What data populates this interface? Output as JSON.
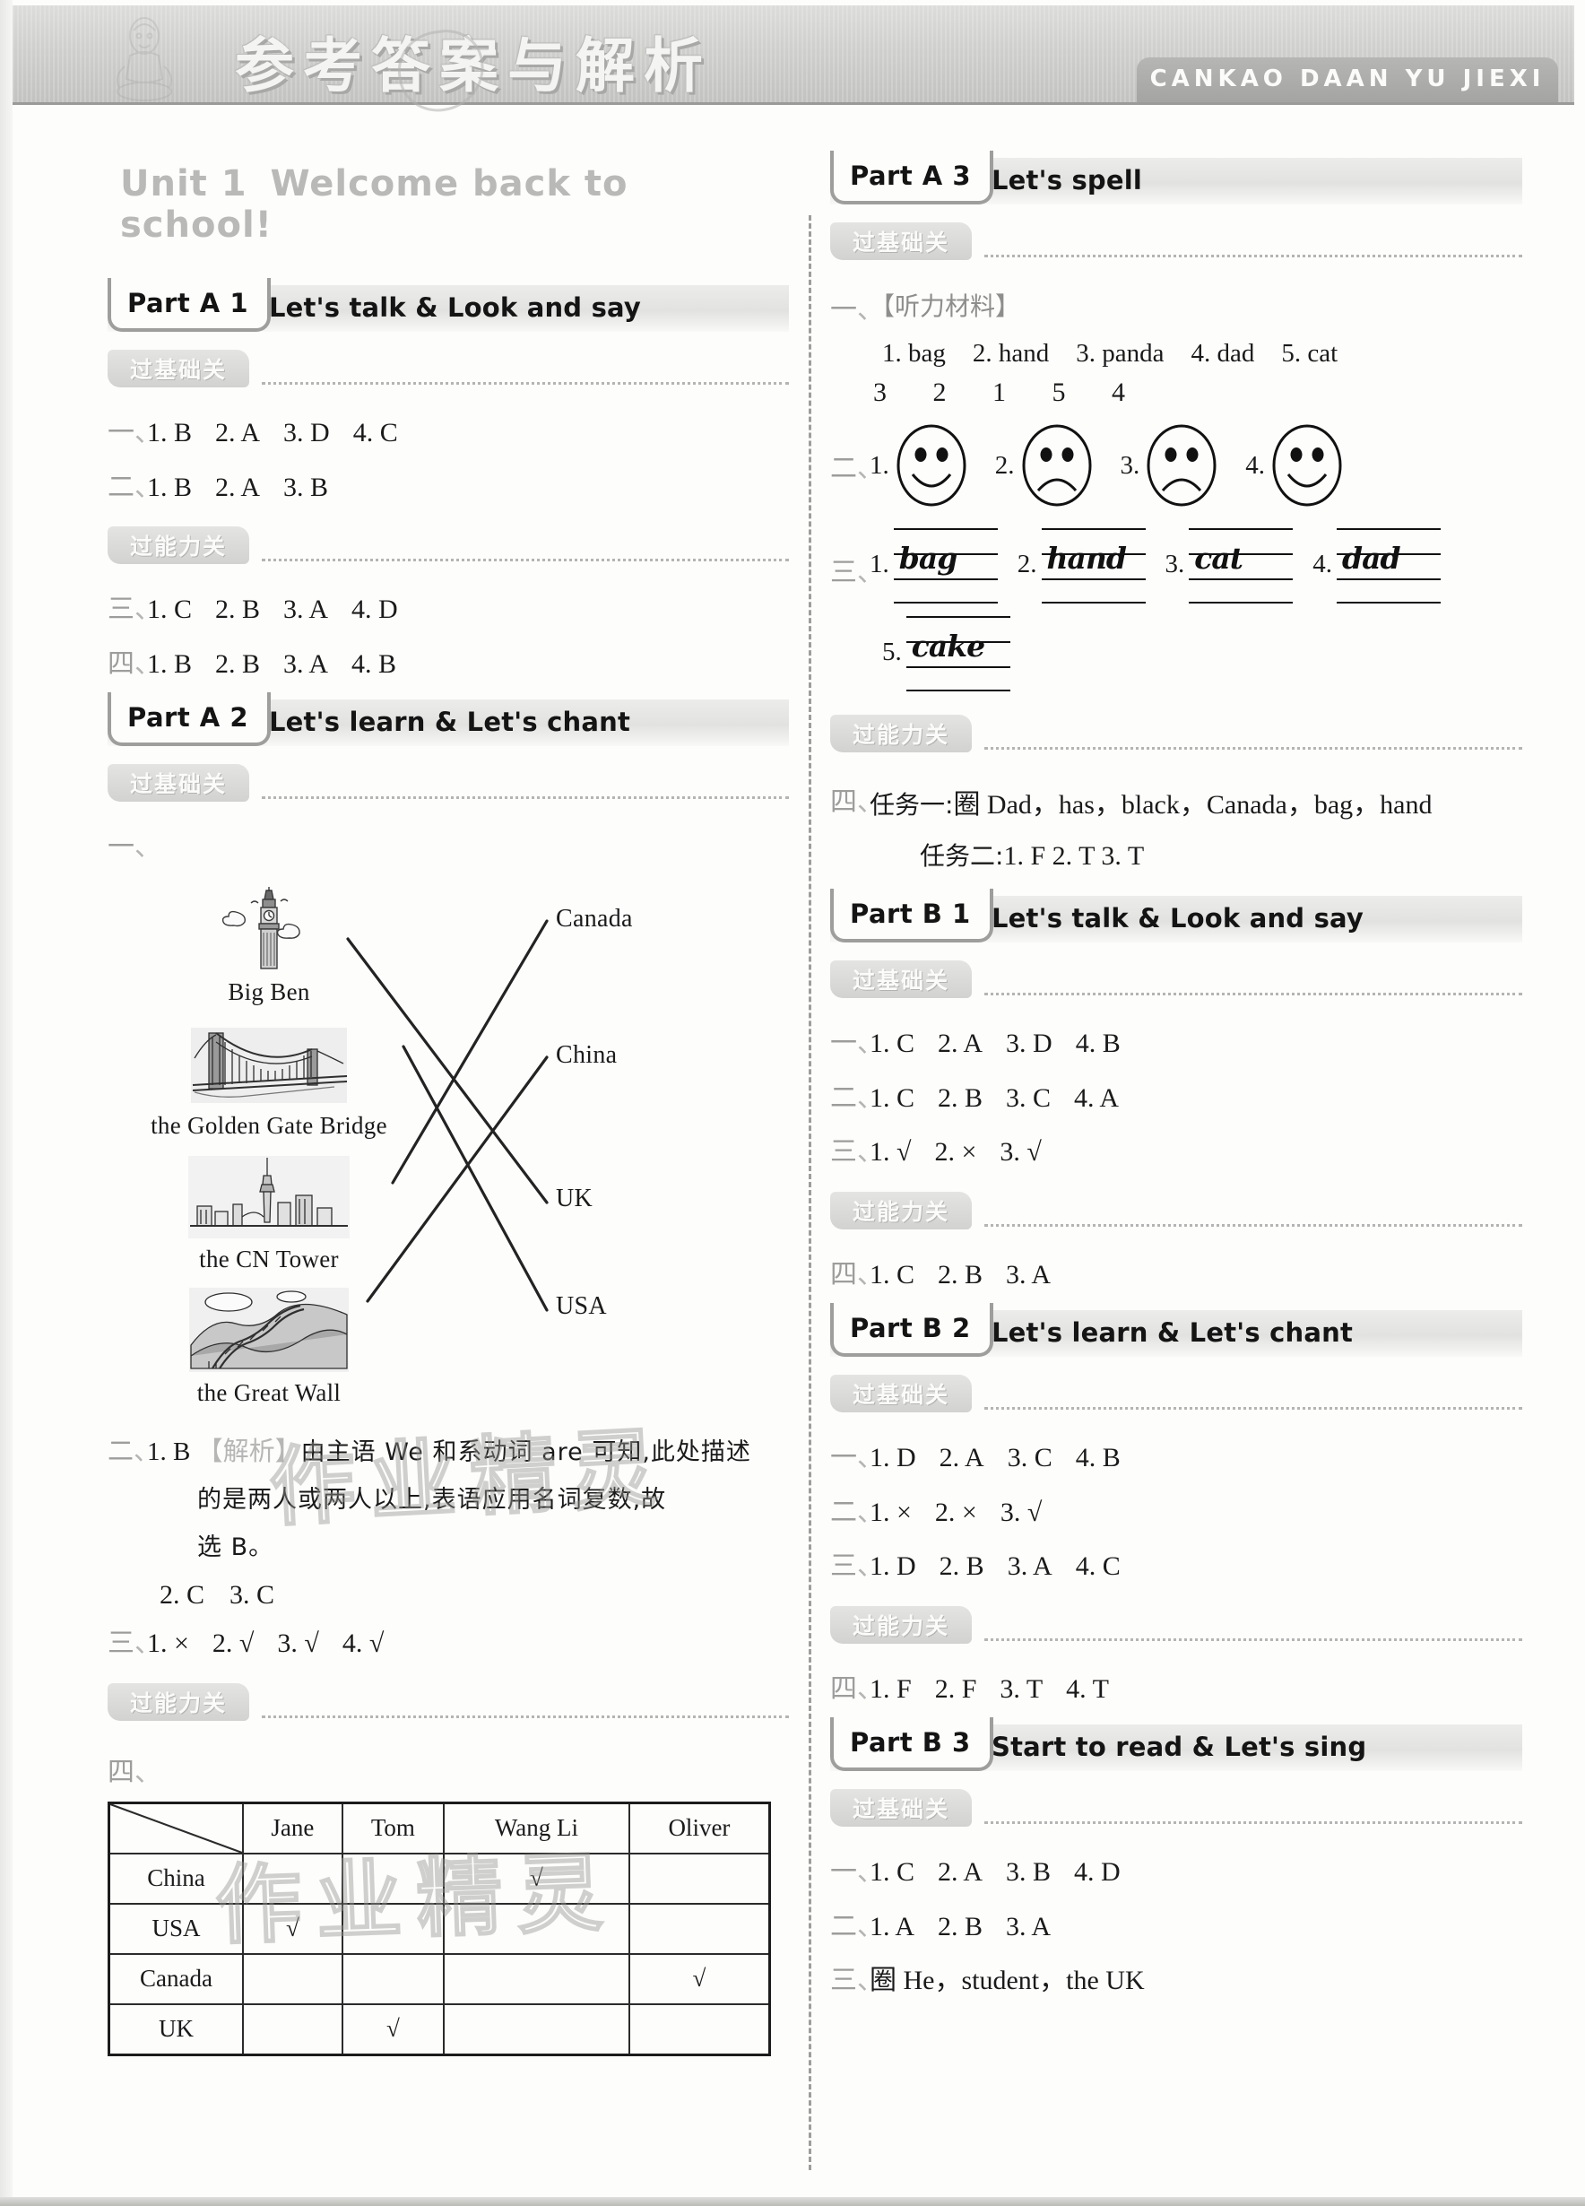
{
  "banner": {
    "title": "参考答案与解析",
    "pinyin": "CANKAO DAAN YU JIEXI",
    "mascot_icon": "mascot-icon",
    "stamp_icon": "seal-stamp-icon"
  },
  "unit": {
    "number": "Unit 1",
    "name": "Welcome back to school!"
  },
  "levels": {
    "basic": "过基础关",
    "ability": "过能力关"
  },
  "watermark": "作业精灵",
  "left": {
    "partA1": {
      "tag": "Part A 1",
      "sub": "Let's talk & Look and say",
      "basic": [
        {
          "num": "一",
          "items": [
            "1. B",
            "2. A",
            "3. D",
            "4. C"
          ]
        },
        {
          "num": "二",
          "items": [
            "1. B",
            "2. A",
            "3. B"
          ]
        }
      ],
      "ability": [
        {
          "num": "三",
          "items": [
            "1. C",
            "2. B",
            "3. A",
            "4. D"
          ]
        },
        {
          "num": "四",
          "items": [
            "1. B",
            "2. B",
            "3. A",
            "4. B"
          ]
        }
      ]
    },
    "partA2": {
      "tag": "Part A 2",
      "sub": "Let's learn & Let's chant",
      "q1_num": "一",
      "match": {
        "left": [
          {
            "caption": "Big Ben",
            "icon": "big-ben-icon"
          },
          {
            "caption": "the Golden Gate Bridge",
            "icon": "golden-gate-bridge-icon"
          },
          {
            "caption": "the CN Tower",
            "icon": "cn-tower-icon"
          },
          {
            "caption": "the Great Wall",
            "icon": "great-wall-icon"
          }
        ],
        "right": [
          "Canada",
          "China",
          "UK",
          "USA"
        ],
        "pairs": [
          {
            "from": "Big Ben",
            "to": "UK"
          },
          {
            "from": "the Golden Gate Bridge",
            "to": "USA"
          },
          {
            "from": "the CN Tower",
            "to": "Canada"
          },
          {
            "from": "the Great Wall",
            "to": "China"
          }
        ]
      },
      "q2_num": "二",
      "q2_first": "1. B",
      "q2_tag": "【解析】",
      "q2_expl_1": "由主语 We 和系动词 are 可知,此处描述",
      "q2_expl_2": "的是两人或两人以上,表语应用名词复数,故",
      "q2_expl_3": "选 B。",
      "q2_rest": [
        "2. C",
        "3. C"
      ],
      "q3_num": "三",
      "q3_items": [
        "1. ×",
        "2. √",
        "3. √",
        "4. √"
      ],
      "q4_num": "四",
      "table": {
        "columns": [
          "Jane",
          "Tom",
          "Wang Li",
          "Oliver"
        ],
        "rows": [
          "China",
          "USA",
          "Canada",
          "UK"
        ],
        "marks": [
          [
            false,
            false,
            true,
            false
          ],
          [
            true,
            false,
            false,
            false
          ],
          [
            false,
            false,
            false,
            true
          ],
          [
            false,
            true,
            false,
            false
          ]
        ],
        "tick": "√"
      }
    }
  },
  "right": {
    "partA3": {
      "tag": "Part A 3",
      "sub": "Let's spell",
      "q1_num": "一",
      "q1_tag": "【听力材料】",
      "q1_words": [
        "1. bag",
        "2. hand",
        "3. panda",
        "4. dad",
        "5. cat"
      ],
      "q1_order": "3 2 1 5 4",
      "q2_num": "二",
      "faces": [
        {
          "label": "1.",
          "mood": "happy"
        },
        {
          "label": "2.",
          "mood": "sad"
        },
        {
          "label": "3.",
          "mood": "sad"
        },
        {
          "label": "4.",
          "mood": "happy"
        }
      ],
      "q3_num": "三",
      "handwriting": [
        {
          "label": "1.",
          "word": "bag"
        },
        {
          "label": "2.",
          "word": "hand"
        },
        {
          "label": "3.",
          "word": "cat"
        },
        {
          "label": "4.",
          "word": "dad"
        },
        {
          "label": "5.",
          "word": "cake"
        }
      ],
      "q4_num": "四",
      "task1_label": "任务一:",
      "task1_value": "圈 Dad，has，black，Canada，bag，hand",
      "task2_label": "任务二:",
      "task2_value": "1. F   2. T   3. T"
    },
    "partB1": {
      "tag": "Part B 1",
      "sub": "Let's talk & Look and say",
      "basic": [
        {
          "num": "一",
          "items": [
            "1. C",
            "2. A",
            "3. D",
            "4. B"
          ]
        },
        {
          "num": "二",
          "items": [
            "1. C",
            "2. B",
            "3. C",
            "4. A"
          ]
        },
        {
          "num": "三",
          "items": [
            "1. √",
            "2. ×",
            "3. √"
          ]
        }
      ],
      "ability": [
        {
          "num": "四",
          "items": [
            "1. C",
            "2. B",
            "3. A"
          ]
        }
      ]
    },
    "partB2": {
      "tag": "Part B 2",
      "sub": "Let's learn & Let's chant",
      "basic": [
        {
          "num": "一",
          "items": [
            "1. D",
            "2. A",
            "3. C",
            "4. B"
          ]
        },
        {
          "num": "二",
          "items": [
            "1. ×",
            "2. ×",
            "3. √"
          ]
        },
        {
          "num": "三",
          "items": [
            "1. D",
            "2. B",
            "3. A",
            "4. C"
          ]
        }
      ],
      "ability": [
        {
          "num": "四",
          "items": [
            "1. F",
            "2. F",
            "3. T",
            "4. T"
          ]
        }
      ]
    },
    "partB3": {
      "tag": "Part B 3",
      "sub": "Start to read & Let's sing",
      "basic": [
        {
          "num": "一",
          "items": [
            "1. C",
            "2. A",
            "3. B",
            "4. D"
          ]
        },
        {
          "num": "二",
          "items": [
            "1. A",
            "2. B",
            "3. A"
          ]
        }
      ],
      "q3_num": "三",
      "q3_value": "圈 He，student，the UK"
    }
  }
}
